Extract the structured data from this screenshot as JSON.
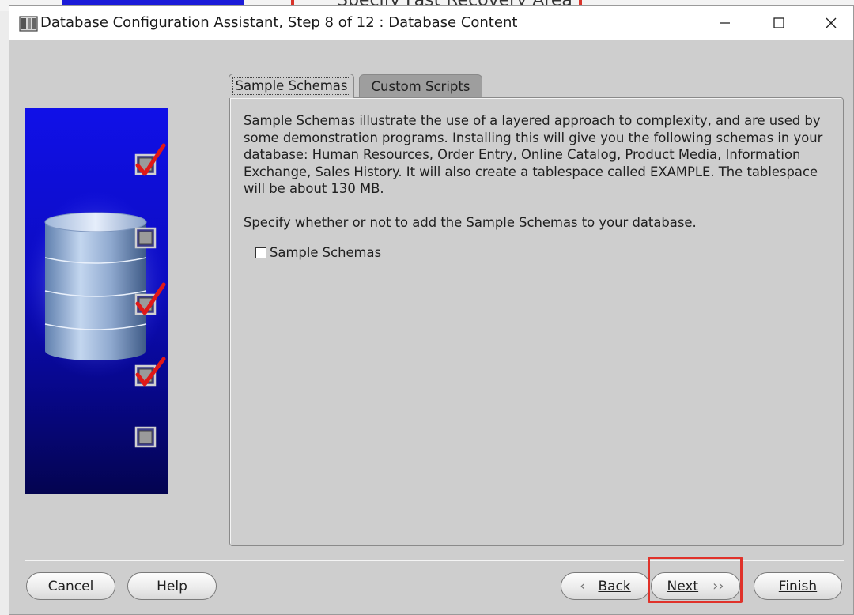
{
  "background_window": {
    "partial_text": "Specify Fast Recovery Area"
  },
  "window": {
    "title": "Database Configuration Assistant, Step 8 of 12 : Database Content",
    "controls": {
      "minimize": "minimize",
      "maximize": "maximize",
      "close": "close"
    }
  },
  "side_graphic": {
    "checklist": [
      {
        "state": "checked"
      },
      {
        "state": "unchecked"
      },
      {
        "state": "checked"
      },
      {
        "state": "checked"
      },
      {
        "state": "unchecked"
      }
    ]
  },
  "tabs": [
    {
      "label": "Sample Schemas",
      "active": true
    },
    {
      "label": "Custom Scripts",
      "active": false
    }
  ],
  "content": {
    "description": "Sample Schemas illustrate the use of a layered approach to complexity, and are used by some demonstration programs. Installing this will give you the following schemas in your database: Human Resources, Order Entry, Online Catalog, Product Media, Information Exchange, Sales History. It will also create a tablespace called EXAMPLE. The tablespace will be about 130 MB.",
    "prompt": "Specify whether or not to add the Sample Schemas to your database.",
    "sample_schemas_checkbox": {
      "label": "Sample Schemas",
      "checked": false
    }
  },
  "buttons": {
    "cancel": "Cancel",
    "help": "Help",
    "back": "Back",
    "next": "Next",
    "finish": "Finish"
  },
  "colors": {
    "highlight": "#e0322a",
    "side_panel_top": "#1010e8",
    "side_panel_bottom": "#040450"
  }
}
